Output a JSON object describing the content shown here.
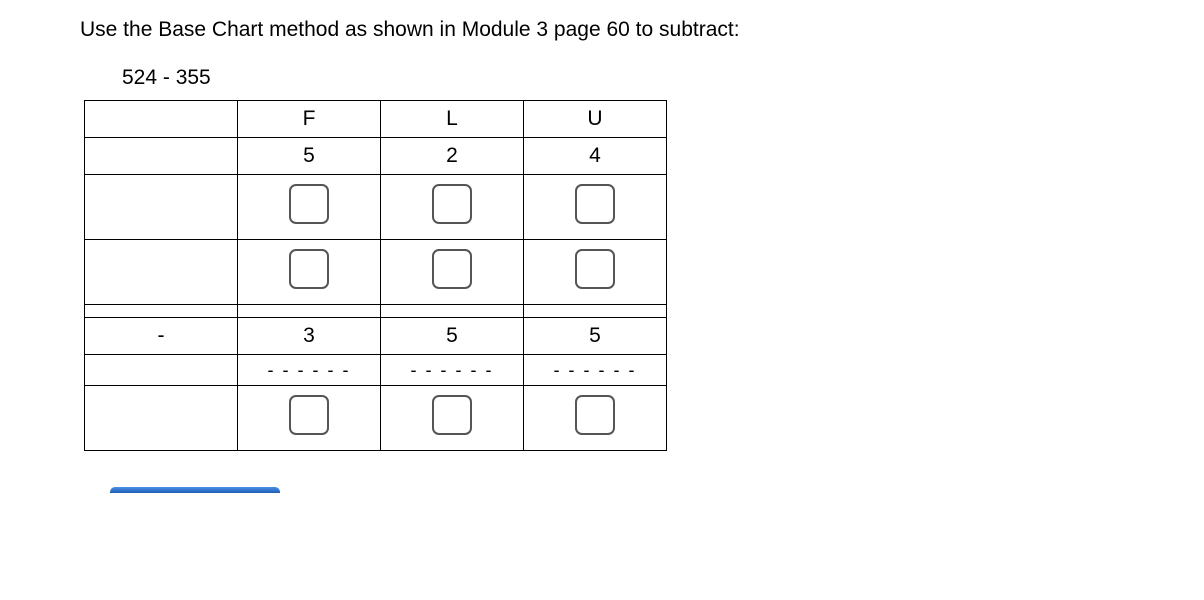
{
  "instruction": "Use the Base Chart method as shown in Module 3 page 60 to subtract:",
  "expression": "524 - 355",
  "headers": {
    "F": "F",
    "L": "L",
    "U": "U"
  },
  "top": {
    "F": "5",
    "L": "2",
    "U": "4"
  },
  "minus": "-",
  "bottom": {
    "F": "3",
    "L": "5",
    "U": "5"
  },
  "dash": "- - - - - -"
}
